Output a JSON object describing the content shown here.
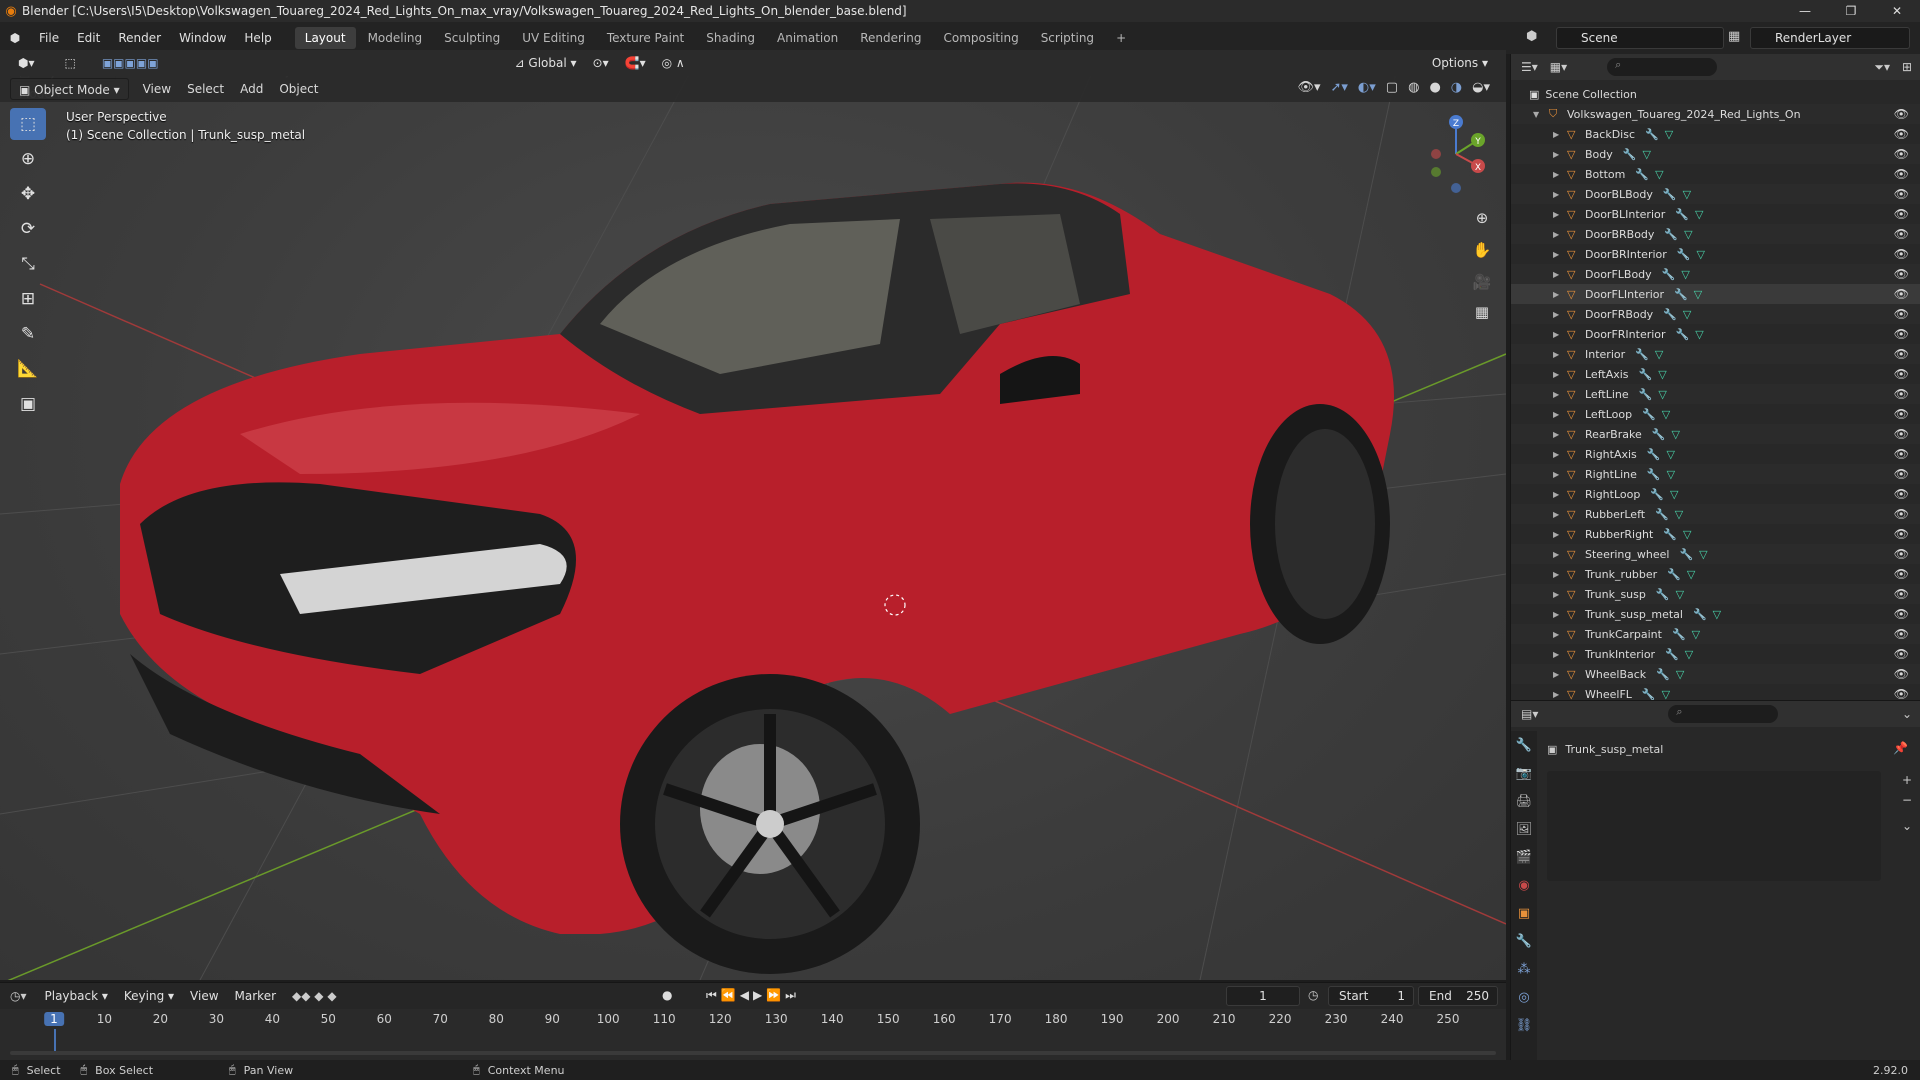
{
  "window": {
    "title": "Blender [C:\\Users\\I5\\Desktop\\Volkswagen_Touareg_2024_Red_Lights_On_max_vray/Volkswagen_Touareg_2024_Red_Lights_On_blender_base.blend]"
  },
  "menu": [
    "File",
    "Edit",
    "Render",
    "Window",
    "Help"
  ],
  "workspaces": [
    {
      "label": "Layout",
      "active": true
    },
    {
      "label": "Modeling"
    },
    {
      "label": "Sculpting"
    },
    {
      "label": "UV Editing"
    },
    {
      "label": "Texture Paint"
    },
    {
      "label": "Shading"
    },
    {
      "label": "Animation"
    },
    {
      "label": "Rendering"
    },
    {
      "label": "Compositing"
    },
    {
      "label": "Scripting"
    }
  ],
  "scene": {
    "name": "Scene",
    "layer": "RenderLayer"
  },
  "viewport": {
    "mode": "Object Mode",
    "menus": [
      "View",
      "Select",
      "Add",
      "Object"
    ],
    "transform_orientation": "Global",
    "options_label": "Options",
    "overlay_line1": "User Perspective",
    "overlay_line2": "(1) Scene Collection | Trunk_susp_metal"
  },
  "gizmo": {
    "z": "Z",
    "y": "Y",
    "x": "X"
  },
  "outliner": {
    "root": "Scene Collection",
    "collection": "Volkswagen_Touareg_2024_Red_Lights_On",
    "items": [
      "BackDisc",
      "Body",
      "Bottom",
      "DoorBLBody",
      "DoorBLInterior",
      "DoorBRBody",
      "DoorBRInterior",
      "DoorFLBody",
      "DoorFLInterior",
      "DoorFRBody",
      "DoorFRInterior",
      "Interior",
      "LeftAxis",
      "LeftLine",
      "LeftLoop",
      "RearBrake",
      "RightAxis",
      "RightLine",
      "RightLoop",
      "RubberLeft",
      "RubberRight",
      "Steering_wheel",
      "Trunk_rubber",
      "Trunk_susp",
      "Trunk_susp_metal",
      "TrunkCarpaint",
      "TrunkInterior",
      "WheelBack",
      "WheelFL"
    ],
    "highlighted": "DoorFLInterior"
  },
  "properties": {
    "object_name": "Trunk_susp_metal"
  },
  "timeline": {
    "menus": [
      "Playback",
      "Keying",
      "View",
      "Marker"
    ],
    "current_frame": "1",
    "start_label": "Start",
    "start": "1",
    "end_label": "End",
    "end": "250",
    "ticks": [
      "1",
      "10",
      "20",
      "30",
      "40",
      "50",
      "60",
      "70",
      "80",
      "90",
      "100",
      "110",
      "120",
      "130",
      "140",
      "150",
      "160",
      "170",
      "180",
      "190",
      "200",
      "210",
      "220",
      "230",
      "240",
      "250"
    ]
  },
  "status": {
    "select": "Select",
    "box_select": "Box Select",
    "pan_view": "Pan View",
    "context_menu": "Context Menu",
    "version": "2.92.0"
  },
  "colors": {
    "accent": "#4772b3",
    "car_red": "#b81f2b",
    "object_orange": "#e8913a",
    "mesh_green": "#48d1a8"
  }
}
